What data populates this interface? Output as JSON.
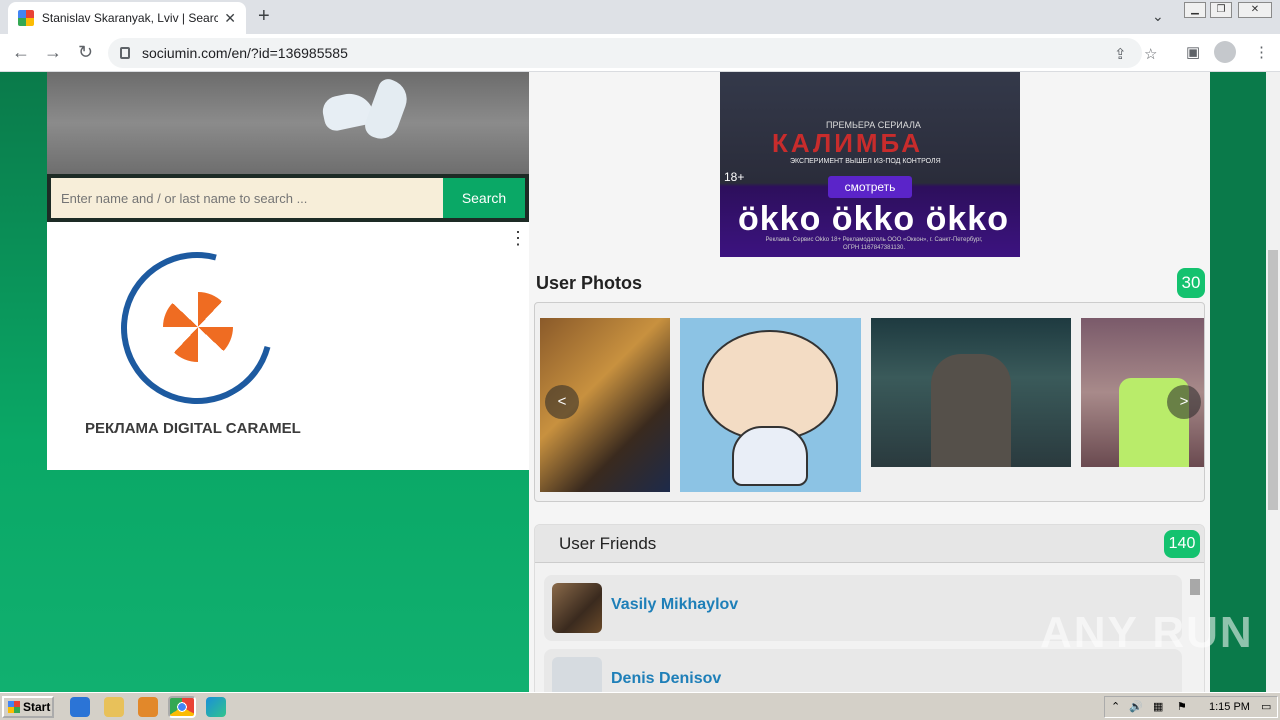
{
  "browser": {
    "tab_title": "Stanislav Skaranyak, Lviv | Search I",
    "url": "sociumin.com/en/?id=136985585",
    "icons": [
      "back-icon",
      "forward-icon",
      "reload-icon",
      "lock-icon",
      "share-icon",
      "star-icon",
      "sidepanel-icon",
      "profile-icon",
      "menu-icon"
    ]
  },
  "search": {
    "placeholder": "Enter name and / or last name to search ...",
    "button_label": "Search"
  },
  "ad_left": {
    "text": "РЕКЛАМА DIGITAL CARAMEL"
  },
  "ad_okko": {
    "premiere": "ПРЕМЬЕРА СЕРИАЛА",
    "title": "КАЛИМБА",
    "subtitle": "ЭКСПЕРИМЕНТ ВЫШЕЛ ИЗ-ПОД КОНТРОЛЯ",
    "age": "18+",
    "button": "смотреть",
    "logos": "ökko ökko ökko",
    "legal": "Реклама. Сервис Okko 18+ Рекламодатель ООО «Оккон», г. Санкт-Петербург, ОГРН 1167847381130."
  },
  "photos": {
    "title": "User Photos",
    "count": "30",
    "prev": "<",
    "next": ">"
  },
  "friends": {
    "title": "User Friends",
    "count": "140",
    "items": [
      {
        "name": "Vasily Mikhaylov"
      },
      {
        "name": "Denis Denisov"
      }
    ]
  },
  "watermark": "ANY RUN",
  "taskbar": {
    "start": "Start",
    "clock": "1:15 PM"
  },
  "colors": {
    "accent_green": "#0aa866",
    "badge_green": "#14c26f",
    "link_blue": "#1e7fb8"
  }
}
